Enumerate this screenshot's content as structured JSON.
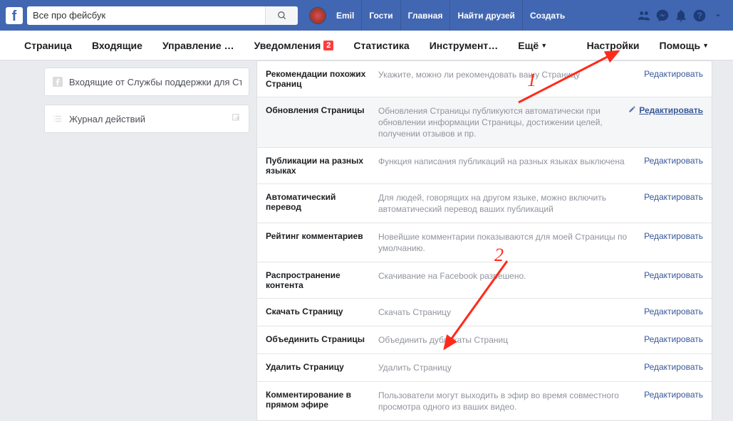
{
  "topbar": {
    "search_value": "Все про фейсбук",
    "user_name": "Emil",
    "links": [
      "Гости",
      "Главная",
      "Найти друзей",
      "Создать"
    ]
  },
  "secnav": {
    "items": [
      {
        "label": "Страница"
      },
      {
        "label": "Входящие"
      },
      {
        "label": "Управление …"
      },
      {
        "label": "Уведомления",
        "badge": "2"
      },
      {
        "label": "Статистика"
      },
      {
        "label": "Инструмент…"
      },
      {
        "label": "Ещё",
        "caret": true
      }
    ],
    "right": [
      {
        "label": "Настройки",
        "strong": true
      },
      {
        "label": "Помощь",
        "caret": true
      }
    ]
  },
  "sidebar": {
    "items": [
      {
        "label": "Входящие от Службы поддержки для Ст"
      },
      {
        "label": "Журнал действий"
      }
    ]
  },
  "settings": {
    "edit_label": "Редактировать",
    "rows": [
      {
        "label": "Рекомендации похожих Страниц",
        "desc": "Укажите, можно ли рекомендовать вашу Страницу"
      },
      {
        "label": "Обновления Страницы",
        "desc": "Обновления Страницы публикуются автоматически при обновлении информации Страницы, достижении целей, получении отзывов и пр.",
        "highlight": true,
        "pencil": true,
        "underline": true
      },
      {
        "label": "Публикации на разных языках",
        "desc": "Функция написания публикаций на разных языках выключена"
      },
      {
        "label": "Автоматический перевод",
        "desc": "Для людей, говорящих на другом языке, можно включить автоматический перевод ваших публикаций"
      },
      {
        "label": "Рейтинг комментариев",
        "desc": "Новейшие комментарии показываются для моей Страницы по умолчанию."
      },
      {
        "label": "Распространение контента",
        "desc": "Скачивание на Facebook разрешено."
      },
      {
        "label": "Скачать Страницу",
        "desc": "Скачать Страницу"
      },
      {
        "label": "Объединить Страницы",
        "desc": "Объединить дубликаты Страниц"
      },
      {
        "label": "Удалить Страницу",
        "desc": "Удалить Страницу"
      },
      {
        "label": "Комментирование в прямом эфире",
        "desc": "Пользователи могут выходить в эфир во время совместного просмотра одного из ваших видео."
      }
    ]
  },
  "annotations": {
    "one": "1",
    "two": "2"
  }
}
